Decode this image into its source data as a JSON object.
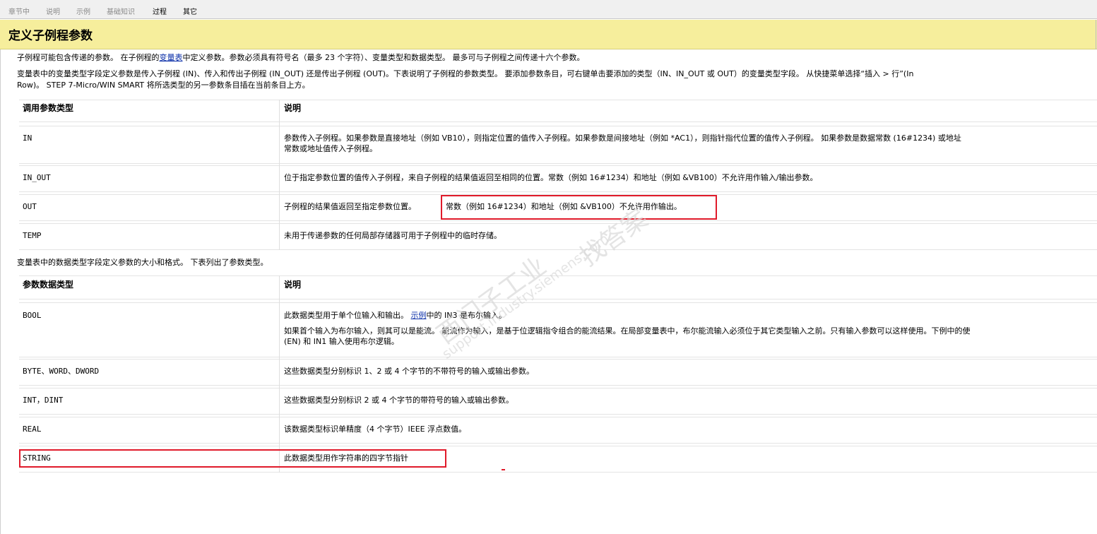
{
  "tabs": [
    {
      "label": "章节中",
      "active": false
    },
    {
      "label": "说明",
      "active": false
    },
    {
      "label": "示例",
      "active": false
    },
    {
      "label": "基础知识",
      "active": false
    },
    {
      "label": "过程",
      "active": true
    },
    {
      "label": "其它",
      "active": true
    }
  ],
  "page_title": "定义子例程参数",
  "intro": {
    "p1_before_link": "子例程可能包含传递的参数。  在子例程的",
    "p1_link": "变量表",
    "p1_after_link": "中定义参数。参数必须具有符号名（最多 23 个字符）、变量类型和数据类型。  最多可与子例程之间传递十六个参数。",
    "p2_line1": "变量表中的变量类型字段定义参数是传入子例程 (IN)、传入和传出子例程 (IN_OUT) 还是传出子例程 (OUT)。下表说明了子例程的参数类型。  要添加参数条目，可右键单击要添加的类型（IN、IN_OUT 或 OUT）的变量类型字段。  从快捷菜单选择“插入 > 行”(In",
    "p2_line2": "Row)。 STEP 7-Micro/WIN SMART 将所选类型的另一参数条目插在当前条目上方。"
  },
  "table1": {
    "headers": [
      "调用参数类型",
      "说明"
    ],
    "rows": [
      {
        "type": "IN",
        "desc_line1": "参数传入子例程。如果参数是直接地址（例如 VB10），则指定位置的值传入子例程。如果参数是间接地址（例如 *AC1），则指针指代位置的值传入子例程。  如果参数是数据常数 (16#1234) 或地址",
        "desc_line2": "常数或地址值传入子例程。"
      },
      {
        "type": "IN_OUT",
        "desc_line1": "位于指定参数位置的值传入子例程，来自子例程的结果值返回至相同的位置。常数（例如 16#1234）和地址（例如 &VB100）不允许用作输入/输出参数。"
      },
      {
        "type": "OUT",
        "desc_part1": "子例程的结果值返回至指定参数位置。",
        "desc_part2": "常数（例如 16#1234）和地址（例如 &VB100）不允许用作输出。"
      },
      {
        "type": "TEMP",
        "desc_line1": "未用于传递参数的任何局部存储器可用于子例程中的临时存储。"
      }
    ]
  },
  "between_text": "变量表中的数据类型字段定义参数的大小和格式。  下表列出了参数类型。",
  "table2": {
    "headers": [
      "参数数据类型",
      "说明"
    ],
    "rows": [
      {
        "type": "BOOL",
        "desc_line1_before": "此数据类型用于单个位输入和输出。  ",
        "desc_line1_link": "示例",
        "desc_line1_after": "中的 IN3 是布尔输入。",
        "desc_line2": "如果首个输入为布尔输入，则其可以是能流。  能流作为输入，是基于位逻辑指令组合的能流结果。在局部变量表中，布尔能流输入必须位于其它类型输入之前。只有输入参数可以这样使用。下例中的使",
        "desc_line3": "(EN) 和 IN1 输入使用布尔逻辑。"
      },
      {
        "type": "BYTE、WORD、DWORD",
        "desc_line1": "这些数据类型分别标识 1、2 或 4 个字节的不带符号的输入或输出参数。"
      },
      {
        "type": "INT，DINT",
        "desc_line1": "这些数据类型分别标识 2 或 4 个字节的带符号的输入或输出参数。"
      },
      {
        "type": "REAL",
        "desc_line1": "该数据类型标识单精度（4 个字节）IEEE 浮点数值。"
      },
      {
        "type": "STRING",
        "desc_line1": "此数据类型用作字符串的四字节指针"
      }
    ]
  },
  "watermark": {
    "cn1": "西门子工业",
    "cn2": "找答案",
    "url": "support.industry.siemens.com"
  }
}
